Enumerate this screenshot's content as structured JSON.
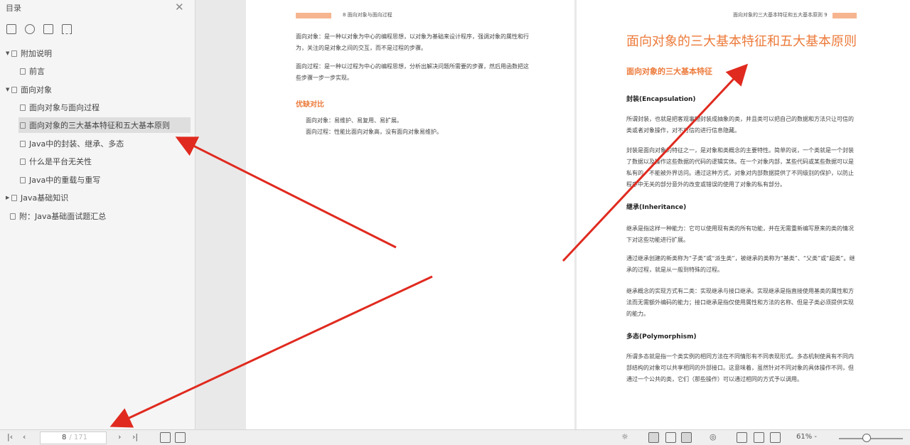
{
  "sidebar": {
    "title": "目录",
    "close_icon": "close-icon",
    "tools": [
      "outline-expand-icon",
      "outline-collapse-icon",
      "bookmark-page-icon",
      "bookmark-icon"
    ],
    "items": [
      {
        "label": "附加说明",
        "caret": "▼"
      },
      {
        "label": "前言",
        "caret": ""
      },
      {
        "label": "面向对象",
        "caret": "▼"
      },
      {
        "label": "面向对象与面向过程",
        "caret": ""
      },
      {
        "label": "面向对象的三大基本特征和五大基本原则",
        "caret": ""
      },
      {
        "label": "Java中的封装、继承、多态",
        "caret": ""
      },
      {
        "label": "什么是平台无关性",
        "caret": ""
      },
      {
        "label": "Java中的重载与重写",
        "caret": ""
      },
      {
        "label": "Java基础知识",
        "caret": "▶"
      },
      {
        "label": "附：Java基础面试题汇总",
        "caret": ""
      }
    ]
  },
  "left_page": {
    "header_text": "8    面向对象与面向过程",
    "para1": "面向对象：是一种以对象为中心的编程思想，以对象为基础来设计程序，强调对象的属性和行为，关注的是对象之间的交互，而不是过程的步骤。",
    "para2": "面向过程：是一种以过程为中心的编程思想，分析出解决问题所需要的步骤，然后用函数把这些步骤一步一步实现。",
    "section": "优缺对比",
    "item1": "面向对象：易维护、易复用、易扩展。",
    "item2": "面向过程：性能比面向对象高，没有面向对象易维护。"
  },
  "right_page": {
    "header_text": "面向对象的三大基本特征和五大基本原则    9",
    "title": "面向对象的三大基本特征和五大基本原则",
    "subtitle": "面向对象的三大基本特征",
    "h_encapsulation": "封装(Encapsulation)",
    "p_enc1": "所谓封装，也就是把客观事物封装成抽象的类，并且类可以把自己的数据和方法只让可信的类或者对象操作，对不可信的进行信息隐藏。",
    "p_enc2": "封装是面向对象的特征之一，是对象和类概念的主要特性。简单的说，一个类就是一个封装了数据以及操作这些数据的代码的逻辑实体。在一个对象内部，某些代码或某些数据可以是私有的，不能被外界访问。通过这种方式，对象对内部数据提供了不同级别的保护，以防止程序中无关的部分意外的改变或错误的使用了对象的私有部分。",
    "h_inheritance": "继承(Inheritance)",
    "p_inh1": "继承是指这样一种能力：它可以使用现有类的所有功能，并在无需重新编写原来的类的情况下对这些功能进行扩展。",
    "p_inh2": "通过继承创建的新类称为“子类”或“派生类”，被继承的类称为“基类”、“父类”或“超类”。继承的过程，就是从一般到特殊的过程。",
    "p_inh3": "继承概念的实现方式有二类：实现继承与接口继承。实现继承是指直接使用基类的属性和方法而无需额外编码的能力；接口继承是指仅使用属性和方法的名称、但是子类必须提供实现的能力。",
    "h_polymorphism": "多态(Polymorphism)",
    "p_poly": "所谓多态就是指一个类实例的相同方法在不同情形有不同表现形式。多态机制使具有不同内部结构的对象可以共享相同的外部接口。这意味着，虽然针对不同对象的具体操作不同，但通过一个公共的类，它们（那些操作）可以通过相同的方式予以调用。"
  },
  "statusbar": {
    "first_icon": "first-page-icon",
    "prev_icon": "prev-page-icon",
    "next_icon": "next-page-icon",
    "last_icon": "last-page-icon",
    "page_value": "8",
    "page_total": "/ 171",
    "zoom": "61% -",
    "zoom_level": 0.4
  },
  "colors": {
    "accent": "#ec7a3a",
    "arrow": "#e02a1f"
  }
}
